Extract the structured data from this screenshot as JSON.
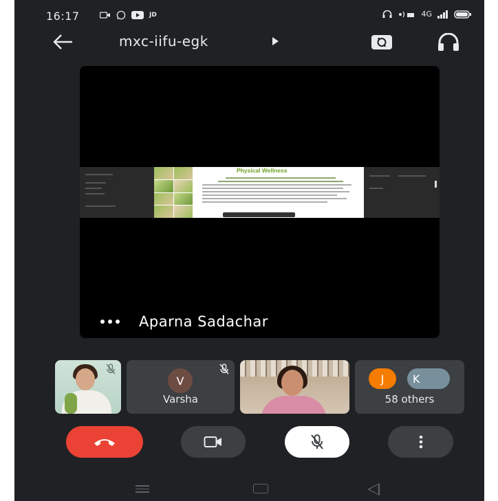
{
  "status_bar": {
    "time": "16:17",
    "carrier_text": "JD",
    "network_text": "4G"
  },
  "header": {
    "meeting_code": "mxc-iifu-egk",
    "icons": [
      "back-arrow-icon",
      "switch-camera-icon",
      "headphones-icon"
    ]
  },
  "main_tile": {
    "presenter_name": "Aparna Sadachar",
    "slide_title": "Physical Wellness"
  },
  "participants": [
    {
      "name": "",
      "muted": true,
      "type": "video"
    },
    {
      "name": "Varsha",
      "initial": "V",
      "muted": true,
      "type": "avatar",
      "avatar_color": "#6d4c41"
    },
    {
      "name": "",
      "muted": false,
      "type": "video"
    },
    {
      "name": "58 others",
      "initials": [
        "J",
        "K"
      ],
      "avatar_colors": [
        "#f57c00",
        "#78909c"
      ],
      "type": "group"
    }
  ],
  "controls": {
    "end_call_color": "#ea4335",
    "icons": [
      "end-call-icon",
      "camera-icon",
      "mic-off-icon",
      "more-options-icon"
    ]
  },
  "colors": {
    "background": "#202124",
    "tile": "#3c4043"
  }
}
